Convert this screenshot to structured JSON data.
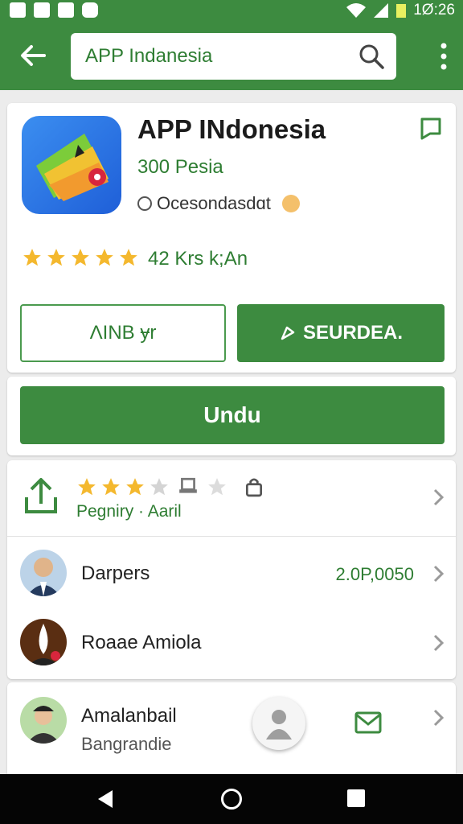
{
  "status_bar": {
    "time": "1Ø:26"
  },
  "search": {
    "query": "APP Indanesia"
  },
  "app": {
    "name": "APP INdonesia",
    "price": "300 Pesia",
    "developer": "Ocesondasdɑt",
    "rating_stars": 5,
    "rating_count": "42 Krs k;An",
    "button_left": "ΛINB ɏr",
    "button_right": "SEURDEA."
  },
  "download": {
    "label": "Undu"
  },
  "review_row": {
    "stars_filled": 3,
    "stars_total": 4,
    "subtitle": "Pegniry · Aaril"
  },
  "list": [
    {
      "name": "Darpers",
      "value": "2.0P,0050"
    },
    {
      "name": "Roaae Amiola"
    },
    {
      "name": "Amalanbail",
      "subtitle": "Bangrandie"
    }
  ],
  "colors": {
    "primary": "#3d8b40",
    "accent_text": "#2e7d32",
    "star": "#f4b82e"
  },
  "icons": [
    "back-arrow-icon",
    "search-icon",
    "more-vert-icon",
    "bookmark-icon",
    "share-icon",
    "chevron-right-icon",
    "mail-icon",
    "person-icon"
  ]
}
